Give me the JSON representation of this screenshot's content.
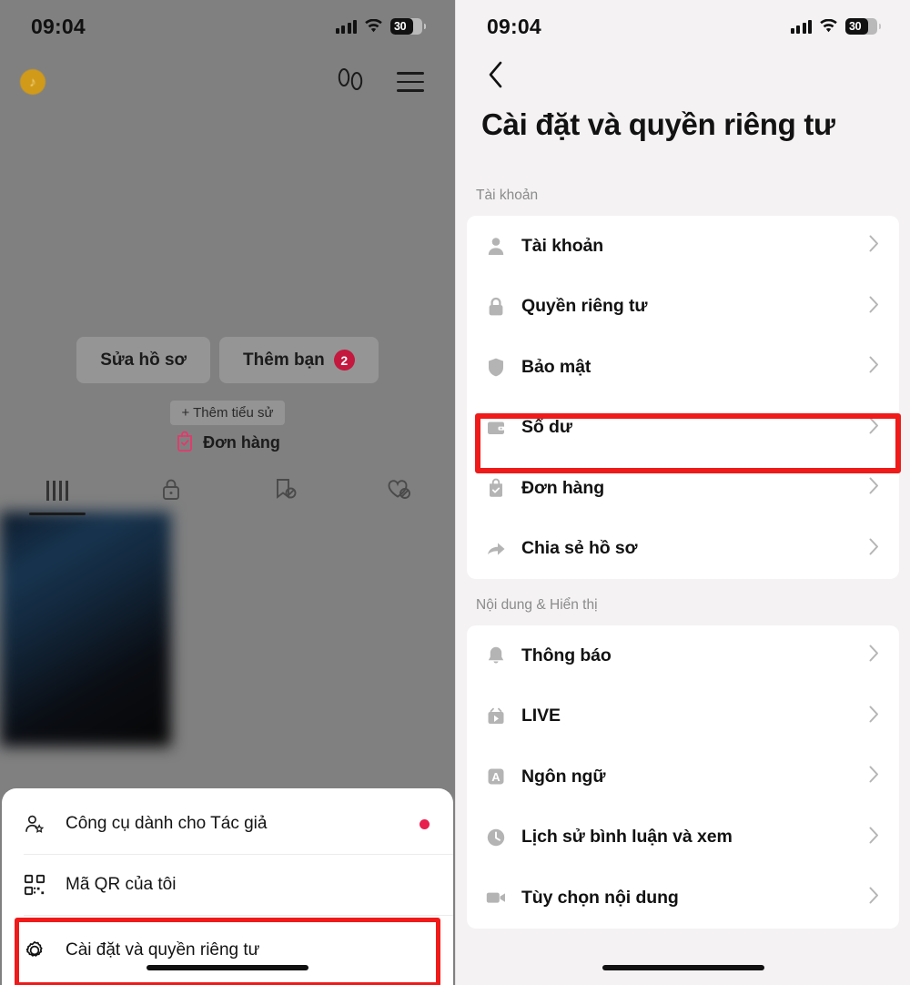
{
  "status_bar": {
    "time": "09:04",
    "battery_percent": "30",
    "signal_icon": "cellular-signal-icon",
    "wifi_icon": "wifi-icon",
    "battery_icon": "battery-icon"
  },
  "left_panel": {
    "topbar": {
      "coin_icon": "tiktok-coin-icon",
      "footsteps_icon": "footsteps-icon",
      "menu_icon": "hamburger-menu-icon"
    },
    "actions": {
      "edit_profile": "Sửa hồ sơ",
      "add_friends": "Thêm bạn",
      "add_friends_count": "2",
      "add_bio": "+ Thêm tiểu sử",
      "orders": "Đơn hàng"
    },
    "tabs": [
      {
        "name": "posts-tab",
        "icon": "grid-icon",
        "active": true
      },
      {
        "name": "private-tab",
        "icon": "lock-icon",
        "active": false
      },
      {
        "name": "saved-tab",
        "icon": "bookmark-hidden-icon",
        "active": false
      },
      {
        "name": "liked-tab",
        "icon": "heart-hidden-icon",
        "active": false
      }
    ],
    "sheet_items": [
      {
        "label": "Công cụ dành cho Tác giả",
        "icon": "creator-tools-icon",
        "badge": true,
        "highlighted": false
      },
      {
        "label": "Mã QR của tôi",
        "icon": "qr-code-icon",
        "badge": false,
        "highlighted": false
      },
      {
        "label": "Cài đặt và quyền riêng tư",
        "icon": "gear-icon",
        "badge": false,
        "highlighted": true
      }
    ]
  },
  "right_panel": {
    "back_icon": "chevron-left-icon",
    "title": "Cài đặt và quyền riêng tư",
    "sections": [
      {
        "label": "Tài khoản",
        "rows": [
          {
            "label": "Tài khoản",
            "icon": "person-icon",
            "highlighted": false
          },
          {
            "label": "Quyền riêng tư",
            "icon": "lock-icon",
            "highlighted": false
          },
          {
            "label": "Bảo mật",
            "icon": "shield-icon",
            "highlighted": false
          },
          {
            "label": "Số dư",
            "icon": "wallet-icon",
            "highlighted": true
          },
          {
            "label": "Đơn hàng",
            "icon": "shopping-bag-icon",
            "highlighted": false
          },
          {
            "label": "Chia sẻ hồ sơ",
            "icon": "share-arrow-icon",
            "highlighted": false
          }
        ]
      },
      {
        "label": "Nội dung & Hiển thị",
        "rows": [
          {
            "label": "Thông báo",
            "icon": "bell-icon",
            "highlighted": false
          },
          {
            "label": "LIVE",
            "icon": "live-icon",
            "highlighted": false
          },
          {
            "label": "Ngôn ngữ",
            "icon": "language-icon",
            "highlighted": false
          },
          {
            "label": "Lịch sử bình luận và xem",
            "icon": "clock-icon",
            "highlighted": false
          },
          {
            "label": "Tùy chọn nội dung",
            "icon": "video-camera-icon",
            "highlighted": false
          }
        ]
      }
    ]
  },
  "colors": {
    "highlight_red": "#ef1a1a",
    "badge_red": "#c4183f",
    "dot_red": "#e8204e",
    "panel_bg": "#f4f2f3",
    "card_bg": "#ffffff",
    "dim_overlay": "#808080"
  }
}
